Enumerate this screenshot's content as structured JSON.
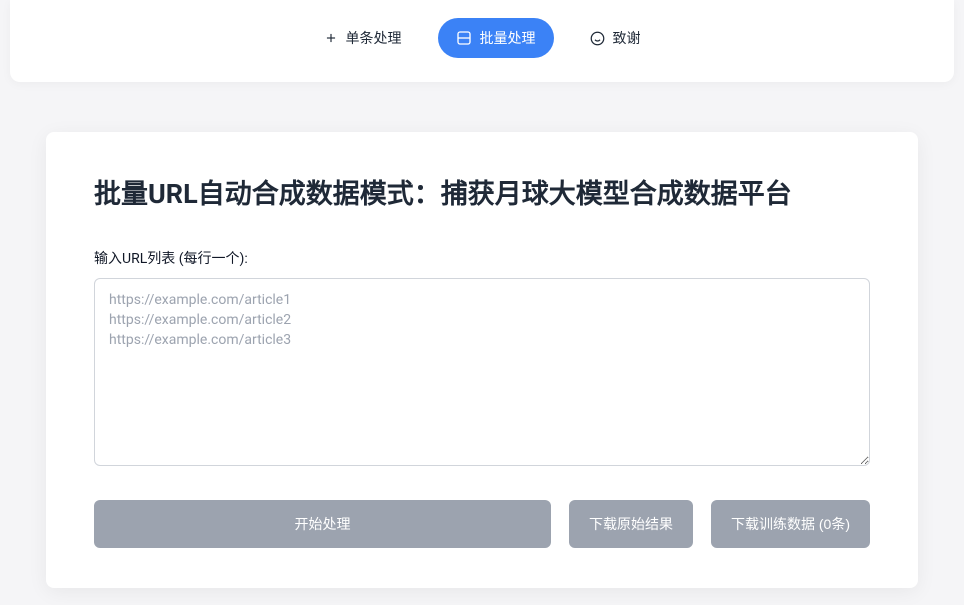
{
  "tabs": {
    "single": "单条处理",
    "batch": "批量处理",
    "thanks": "致谢"
  },
  "main": {
    "title": "批量URL自动合成数据模式：捕获月球大模型合成数据平台",
    "url_label": "输入URL列表 (每行一个):",
    "url_placeholder": "https://example.com/article1\nhttps://example.com/article2\nhttps://example.com/article3",
    "url_value": ""
  },
  "buttons": {
    "start": "开始处理",
    "download_raw": "下载原始结果",
    "download_train": "下载训练数据 (0条)"
  }
}
